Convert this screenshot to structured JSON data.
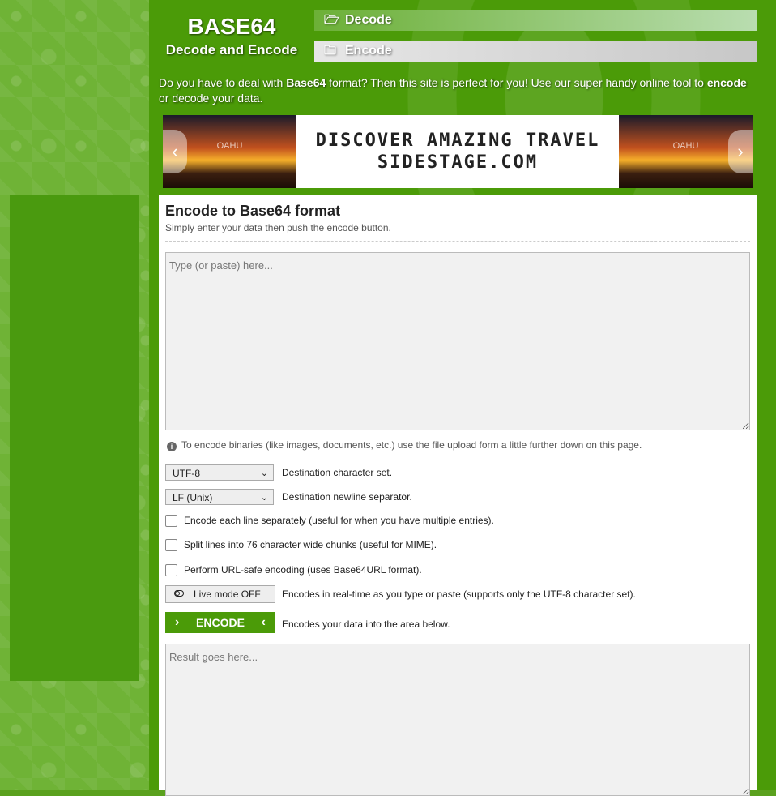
{
  "brand": {
    "title": "BASE64",
    "subtitle": "Decode and Encode"
  },
  "nav": {
    "decode": {
      "icon": "folder-open-icon",
      "label": "Decode"
    },
    "encode": {
      "icon": "folder-icon",
      "label": "Encode"
    }
  },
  "intro": {
    "part1": "Do you have to deal with ",
    "bold1": "Base64",
    "part2": " format? Then this site is perfect for you! Use our super handy online tool to ",
    "bold2": "encode",
    "part3": " or decode your data."
  },
  "banner": {
    "line1": "DISCOVER AMAZING TRAVEL",
    "line2": "SIDESTAGE.COM",
    "tag_left": "OAHU",
    "tag_right": "OAHU",
    "prev": "‹",
    "next": "›"
  },
  "panel": {
    "heading": "Encode to Base64 format",
    "subheading": "Simply enter your data then push the encode button.",
    "input_placeholder": "Type (or paste) here...",
    "hint": "To encode binaries (like images, documents, etc.) use the file upload form a little further down on this page.",
    "charset": {
      "value": "UTF-8",
      "desc": "Destination character set."
    },
    "newline": {
      "value": "LF (Unix)",
      "desc": "Destination newline separator."
    },
    "options": [
      {
        "label": "Encode each line separately (useful for when you have multiple entries).",
        "checked": false
      },
      {
        "label": "Split lines into 76 character wide chunks (useful for MIME).",
        "checked": false
      },
      {
        "label": "Perform URL-safe encoding (uses Base64URL format).",
        "checked": false
      }
    ],
    "live_mode": {
      "label": "Live mode OFF",
      "desc": "Encodes in real-time as you type or paste (supports only the UTF-8 character set)."
    },
    "encode_button": {
      "label": "ENCODE",
      "desc": "Encodes your data into the area below."
    },
    "result_placeholder": "Result goes here..."
  },
  "colors": {
    "accent": "#4b9b08",
    "sidebar": "#6fb336"
  }
}
